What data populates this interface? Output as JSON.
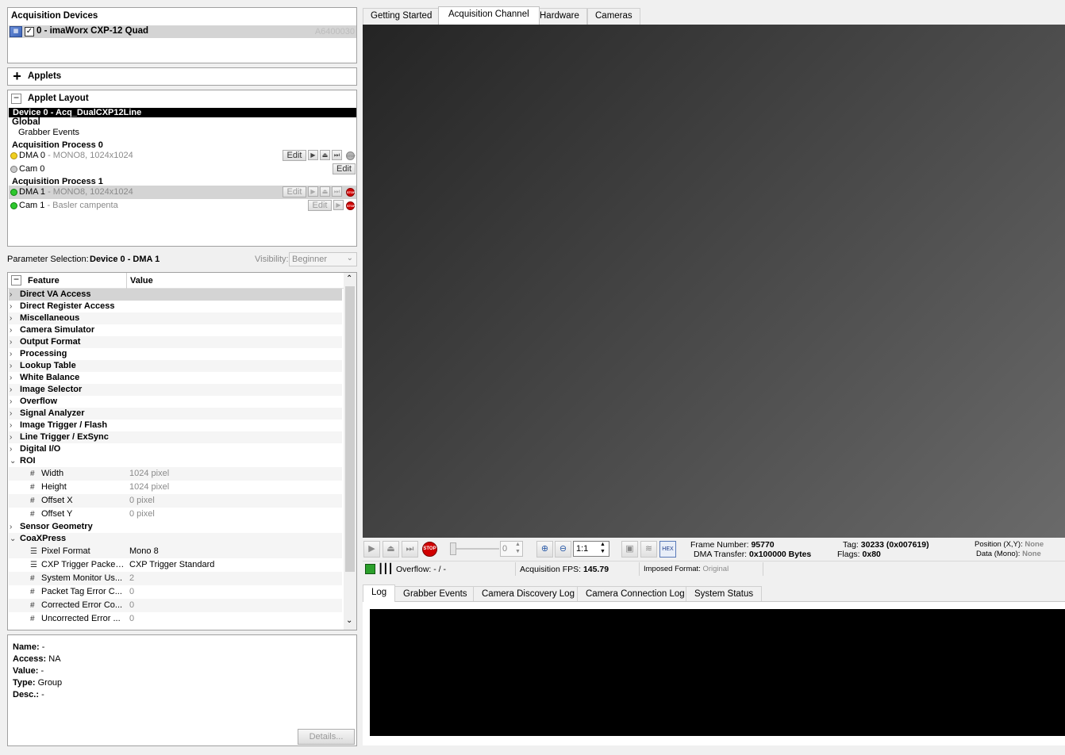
{
  "devices": {
    "title": "Acquisition Devices",
    "device": {
      "name": "0 - imaWorx CXP-12 Quad",
      "serial": "A6400030"
    }
  },
  "applets": {
    "label": "Applets"
  },
  "layout": {
    "title": "Applet Layout",
    "device_header": "Device 0 - Acq_DualCXP12Line",
    "global": "Global",
    "grabber_events": "Grabber Events",
    "process0": "Acquisition Process 0",
    "dma0": {
      "name": "DMA 0",
      "info": " - MONO8, 1024x1024"
    },
    "cam0": {
      "name": "Cam 0"
    },
    "process1": "Acquisition Process 1",
    "dma1": {
      "name": "DMA 1",
      "info": " - MONO8, 1024x1024"
    },
    "cam1": {
      "name": "Cam 1",
      "info": " - Basler campenta"
    },
    "edit": "Edit"
  },
  "param": {
    "label": "Parameter Selection:",
    "value": "Device 0 - DMA 1",
    "visibility_label": "Visibility:",
    "visibility_value": "Beginner"
  },
  "tree": {
    "col_feature": "Feature",
    "col_value": "Value",
    "groups": [
      "Direct VA Access",
      "Direct Register Access",
      "Miscellaneous",
      "Camera Simulator",
      "Output Format",
      "Processing",
      "Lookup Table",
      "White Balance",
      "Image Selector",
      "Overflow",
      "Signal Analyzer",
      "Image Trigger / Flash",
      "Line Trigger / ExSync",
      "Digital I/O"
    ],
    "roi": {
      "label": "ROI",
      "items": [
        {
          "icon": "#",
          "name": "Width",
          "value": "1024 pixel"
        },
        {
          "icon": "#",
          "name": "Height",
          "value": "1024 pixel"
        },
        {
          "icon": "#",
          "name": "Offset X",
          "value": "0 pixel"
        },
        {
          "icon": "#",
          "name": "Offset Y",
          "value": "0 pixel"
        }
      ]
    },
    "sensor": "Sensor Geometry",
    "coax": {
      "label": "CoaXPress",
      "items": [
        {
          "icon": "☰",
          "name": "Pixel Format",
          "value": "Mono 8"
        },
        {
          "icon": "☰",
          "name": "CXP Trigger Packet ...",
          "value": "CXP Trigger Standard"
        },
        {
          "icon": "#",
          "name": "System Monitor Us...",
          "value": "2"
        },
        {
          "icon": "#",
          "name": "Packet Tag Error C...",
          "value": "0"
        },
        {
          "icon": "#",
          "name": "Corrected Error Co...",
          "value": "0"
        },
        {
          "icon": "#",
          "name": "Uncorrected Error ...",
          "value": "0"
        }
      ]
    }
  },
  "info": {
    "name_label": "Name:",
    "name_value": "-",
    "access_label": "Access:",
    "access_value": "NA",
    "value_label": "Value:",
    "value_value": "-",
    "type_label": "Type:",
    "type_value": "Group",
    "desc_label": "Desc.:",
    "desc_value": "-",
    "details": "Details..."
  },
  "tabs": [
    "Getting Started",
    "Acquisition Channel",
    "Hardware",
    "Cameras"
  ],
  "toolbar": {
    "slider_value": "0",
    "zoom": "1:1",
    "hex": "HEX",
    "frame_label": "Frame Number:",
    "frame_value": "95770",
    "dma_label": "DMA Transfer:",
    "dma_value": "0x100000 Bytes",
    "tag_label": "Tag:",
    "tag_value": "30233 (0x007619)",
    "flags_label": "Flags:",
    "flags_value": "0x80",
    "pos_label": "Position (X,Y):",
    "pos_value": "None",
    "data_label": "Data (Mono):",
    "data_value": "None"
  },
  "status": {
    "overflow_label": "Overflow:",
    "overflow_value": "- / -",
    "fps_label": "Acquisition FPS:",
    "fps_value": "145.79",
    "imposed_label": "Imposed Format:",
    "imposed_value": "Original"
  },
  "bottom_tabs": [
    "Log",
    "Grabber Events",
    "Camera Discovery Log",
    "Camera Connection Log",
    "System Status"
  ]
}
